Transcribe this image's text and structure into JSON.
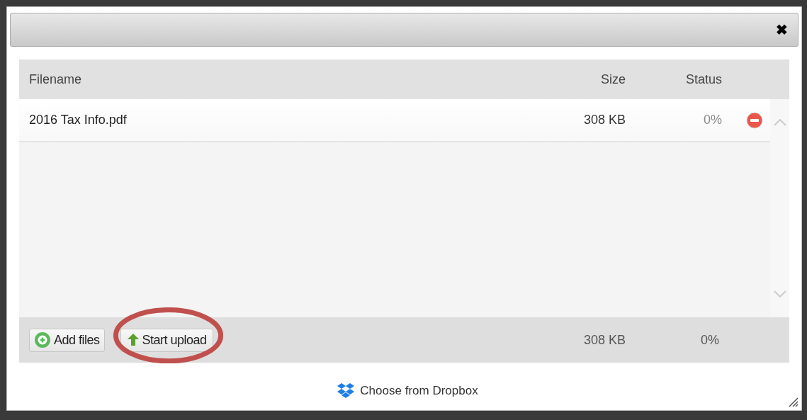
{
  "dialog": {
    "close": "✖"
  },
  "table": {
    "columns": [
      "Filename",
      "Size",
      "Status"
    ],
    "rows": [
      {
        "filename": "2016 Tax Info.pdf",
        "size": "308 KB",
        "status": "0%"
      }
    ]
  },
  "footer": {
    "buttons": [
      {
        "kind": "add",
        "label": "Add files",
        "circled": false
      },
      {
        "kind": "upload",
        "label": "Start upload",
        "circled": true
      }
    ],
    "total_size": "308 KB",
    "total_status": "0%"
  },
  "dropbox_link": "Choose from Dropbox"
}
